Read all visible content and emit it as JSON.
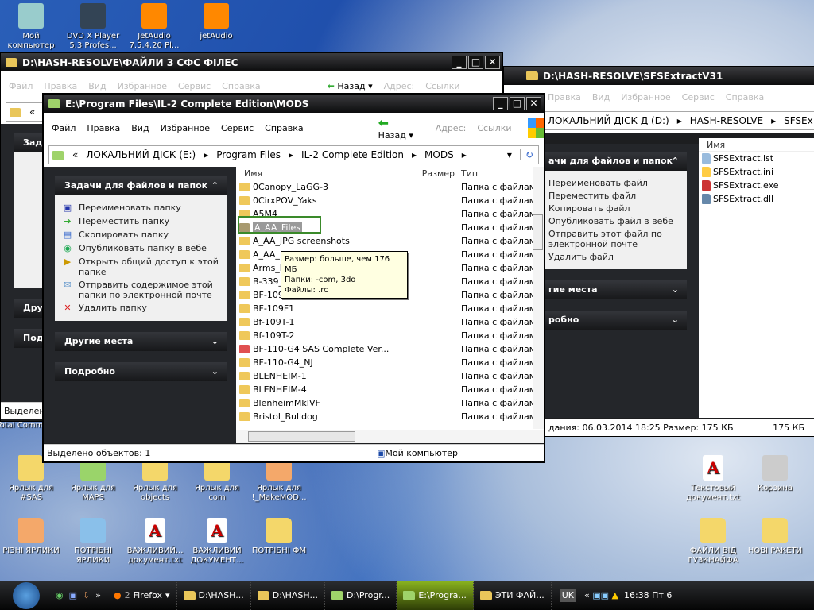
{
  "desktop": {
    "top_icons": [
      {
        "label": "Мой компьютер"
      },
      {
        "label": "DVD X Player 5.3 Profes..."
      },
      {
        "label": "JetAudio 7.5.4.20 Pl..."
      },
      {
        "label": "jetAudio"
      }
    ],
    "row1": [
      {
        "label": "Ярлык для #SAS"
      },
      {
        "label": "Ярлык для MAPS"
      },
      {
        "label": "Ярлык для objects"
      },
      {
        "label": "Ярлык для com"
      },
      {
        "label": "Ярлык для !_MakeMOD..."
      }
    ],
    "row2": [
      {
        "label": "РІЗНІ ЯРЛИКИ"
      },
      {
        "label": "ПОТРІБНІ ЯРЛИКИ"
      },
      {
        "label": "ВАЖЛИВИЙ... документ.txt"
      },
      {
        "label": "ВАЖЛИВИЙ ДОКУМЕНТ..."
      },
      {
        "label": "ПОТРІБНІ ФМ"
      }
    ],
    "right": [
      {
        "label": "Текстовый документ.txt"
      },
      {
        "label": "Корзина"
      },
      {
        "label": "ФАЙЛИ ВІД ГУЗКНАЙФА"
      },
      {
        "label": "НОВІ РАКЕТИ"
      }
    ],
    "partial_label": "Total Comman"
  },
  "win_back1": {
    "title": "D:\\HASH-RESOLVE\\ФАЙЛИ З СФС ФІЛЕС",
    "menu": [
      "Файл",
      "Правка",
      "Вид",
      "Избранное",
      "Сервис",
      "Справка"
    ],
    "back": "Назад",
    "address": "Адрес:",
    "links": "Ссылки",
    "tasks_h": "Зад",
    "other_h": "Дру",
    "details_h": "Под",
    "status": "Выделен"
  },
  "win_back2": {
    "title": "D:\\HASH-RESOLVE\\SFSExtractV31",
    "menu": [
      "Правка",
      "Вид",
      "Избранное",
      "Сервис",
      "Справка"
    ],
    "crumbs": [
      "ЛОКАЛЬНИЙ ДІСК Д (D:)",
      "HASH-RESOLVE",
      "SFSEx"
    ],
    "tasks_h": "ачи для файлов и папок",
    "tasks": [
      "Переименовать файл",
      "Переместить файл",
      "Копировать файл",
      "Опубликовать файл в вебе",
      "Отправить этот файл по электронной почте",
      "Удалить файл"
    ],
    "other_h": "гие места",
    "details_h": "робно",
    "col_name": "Имя",
    "files": [
      "SFSExtract.lst",
      "SFSExtract.ini",
      "SFSExtract.exe",
      "SFSExtract.dll"
    ],
    "status_left": "дания: 06.03.2014 18:25 Размер: 175 КБ",
    "status_right": "175 КБ"
  },
  "main": {
    "title": "E:\\Program Files\\IL-2 Complete Edition\\MODS",
    "menu": [
      "Файл",
      "Правка",
      "Вид",
      "Избранное",
      "Сервис",
      "Справка"
    ],
    "back": "Назад",
    "address": "Адрес:",
    "links": "Ссылки",
    "crumbs": [
      "ЛОКАЛЬНИЙ ДІСК (E:)",
      "Program Files",
      "IL-2 Complete Edition",
      "MODS"
    ],
    "tasks_h": "Задачи для файлов и папок",
    "tasks": [
      "Переименовать папку",
      "Переместить папку",
      "Скопировать папку",
      "Опубликовать папку в вебе",
      "Открыть общий доступ к этой папке",
      "Отправить содержимое этой папки по электронной почте",
      "Удалить папку"
    ],
    "other_h": "Другие места",
    "details_h": "Подробно",
    "cols": {
      "name": "Имя",
      "size": "Размер",
      "type": "Тип"
    },
    "rows": [
      {
        "name": "0Canopy_LaGG-3"
      },
      {
        "name": "0CirxPOV_Yaks"
      },
      {
        "name": "A5M4"
      },
      {
        "name": "A_AA_Files",
        "selected": true
      },
      {
        "name": "A_AA_JPG screenshots"
      },
      {
        "name": "A_AA_"
      },
      {
        "name": "Arms_F"
      },
      {
        "name": "B-339_"
      },
      {
        "name": "BF-109-E3"
      },
      {
        "name": "BF-109F1"
      },
      {
        "name": "Bf-109T-1"
      },
      {
        "name": "Bf-109T-2"
      },
      {
        "name": "BF-110-G4 SAS Complete Ver...",
        "red": true
      },
      {
        "name": "BF-110-G4_NJ"
      },
      {
        "name": "BLENHEIM-1"
      },
      {
        "name": "BLENHEIM-4"
      },
      {
        "name": "BlenheimMkIVF"
      },
      {
        "name": "Bristol_Bulldog"
      }
    ],
    "type_label": "Папка с файлами",
    "tooltip": [
      "Размер: больше, чем 176 МБ",
      "Папки: -com, 3do",
      "Файлы: .rc"
    ],
    "status_left": "Выделено объектов: 1",
    "status_right": "Мой компьютер"
  },
  "taskbar": {
    "items": [
      "Firefox",
      "D:\\HASH...",
      "D:\\HASH...",
      "D:\\Progr...",
      "E:\\Progra...",
      "ЭТИ ФАЙ..."
    ],
    "ff_count": "2",
    "lang": "UK",
    "clock": "16:38 Пт 6"
  }
}
